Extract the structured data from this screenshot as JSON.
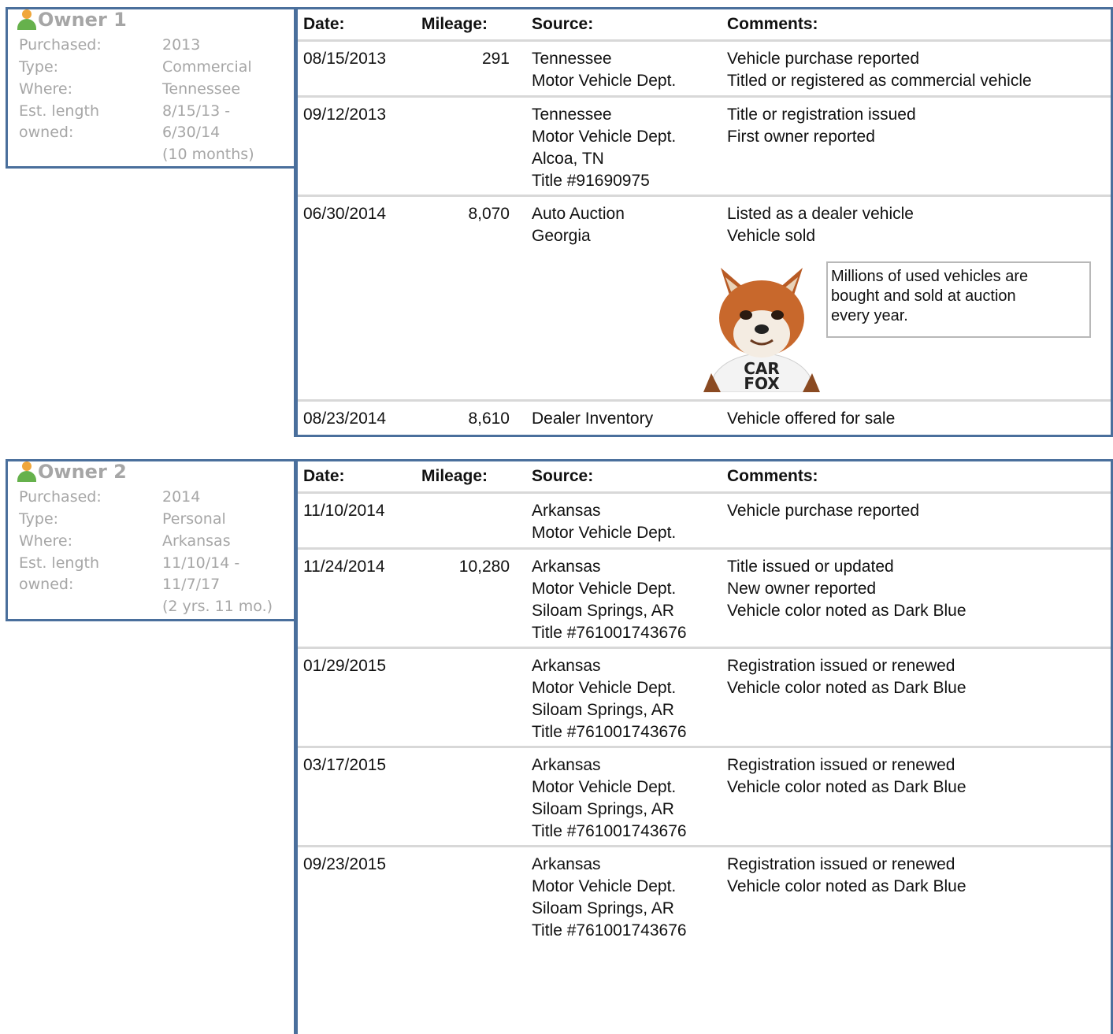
{
  "owners": [
    {
      "title": "Owner 1",
      "info": [
        {
          "label": "Purchased:",
          "value": "2013"
        },
        {
          "label": "Type:",
          "value": "Commercial"
        },
        {
          "label": "Where:",
          "value": "Tennessee"
        },
        {
          "label": "Est. length",
          "value": "8/15/13 -"
        },
        {
          "label": "owned:",
          "value": "6/30/14"
        },
        {
          "label": "",
          "value": "(10 months)"
        }
      ],
      "headers": {
        "date": "Date:",
        "mileage": "Mileage:",
        "source": "Source:",
        "comments": "Comments:"
      },
      "records": [
        {
          "date": "08/15/2013",
          "mileage": "291",
          "source": [
            "Tennessee",
            "Motor Vehicle Dept."
          ],
          "comments": [
            "Vehicle purchase reported",
            "Titled or registered as commercial vehicle"
          ]
        },
        {
          "date": "09/12/2013",
          "mileage": "",
          "source": [
            "Tennessee",
            "Motor Vehicle Dept.",
            "Alcoa, TN",
            "Title #91690975"
          ],
          "comments": [
            "Title or registration issued",
            "First owner reported"
          ]
        },
        {
          "date": "06/30/2014",
          "mileage": "8,070",
          "source": [
            "Auto Auction",
            "Georgia"
          ],
          "comments": [
            "Listed as a dealer vehicle",
            "Vehicle sold"
          ]
        },
        {
          "date": "08/23/2014",
          "mileage": "8,610",
          "source": [
            "Dealer Inventory"
          ],
          "comments": [
            "Vehicle offered for sale"
          ]
        }
      ],
      "tip": [
        "Millions of used vehicles are",
        "bought and sold at auction",
        "every year."
      ],
      "fox_shirt": [
        "CAR",
        "FOX"
      ]
    },
    {
      "title": "Owner 2",
      "info": [
        {
          "label": "Purchased:",
          "value": "2014"
        },
        {
          "label": "Type:",
          "value": "Personal"
        },
        {
          "label": "Where:",
          "value": "Arkansas"
        },
        {
          "label": "Est. length",
          "value": "11/10/14 -"
        },
        {
          "label": "owned:",
          "value": "11/7/17"
        },
        {
          "label": "",
          "value": "(2 yrs. 11 mo.)"
        }
      ],
      "headers": {
        "date": "Date:",
        "mileage": "Mileage:",
        "source": "Source:",
        "comments": "Comments:"
      },
      "records": [
        {
          "date": "11/10/2014",
          "mileage": "",
          "source": [
            "Arkansas",
            "Motor Vehicle Dept."
          ],
          "comments": [
            "Vehicle purchase reported"
          ]
        },
        {
          "date": "11/24/2014",
          "mileage": "10,280",
          "source": [
            "Arkansas",
            "Motor Vehicle Dept.",
            "Siloam Springs, AR",
            "Title #761001743676"
          ],
          "comments": [
            "Title issued or updated",
            "New owner reported",
            "Vehicle color noted as Dark Blue"
          ]
        },
        {
          "date": "01/29/2015",
          "mileage": "",
          "source": [
            "Arkansas",
            "Motor Vehicle Dept.",
            "Siloam Springs, AR",
            "Title #761001743676"
          ],
          "comments": [
            "Registration issued or renewed",
            "Vehicle color noted as Dark Blue"
          ]
        },
        {
          "date": "03/17/2015",
          "mileage": "",
          "source": [
            "Arkansas",
            "Motor Vehicle Dept.",
            "Siloam Springs, AR",
            "Title #761001743676"
          ],
          "comments": [
            "Registration issued or renewed",
            "Vehicle color noted as Dark Blue"
          ]
        },
        {
          "date": "09/23/2015",
          "mileage": "",
          "source": [
            "Arkansas",
            "Motor Vehicle Dept.",
            "Siloam Springs, AR",
            "Title #761001743676"
          ],
          "comments": [
            "Registration issued or renewed",
            "Vehicle color noted as Dark Blue"
          ]
        }
      ]
    }
  ],
  "colors": {
    "border": "#4a6f9c",
    "muted_text": "#a6a6a6",
    "divider": "#d8d8d8"
  }
}
